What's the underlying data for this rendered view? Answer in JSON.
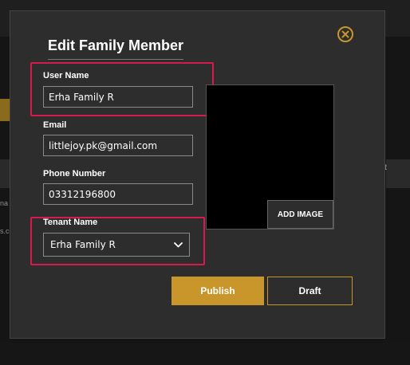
{
  "background": {
    "right_column_text": "ant\npe",
    "left_row_text_1": "na",
    "left_row_text_2": "s.co"
  },
  "modal": {
    "title": "Edit Family Member",
    "close_icon": "close-circle-icon",
    "fields": {
      "user_name": {
        "label": "User Name",
        "value": "Erha Family R"
      },
      "email": {
        "label": "Email",
        "value": "littlejoy.pk@gmail.com"
      },
      "phone": {
        "label": "Phone Number",
        "value": "03312196800"
      },
      "tenant": {
        "label": "Tenant Name",
        "selected": "Erha Family R"
      }
    },
    "add_image_label": "ADD IMAGE",
    "publish_label": "Publish",
    "draft_label": "Draft"
  },
  "colors": {
    "accent": "#c8962b",
    "highlight": "#d8184f",
    "modal_bg": "#2d2d2d"
  }
}
